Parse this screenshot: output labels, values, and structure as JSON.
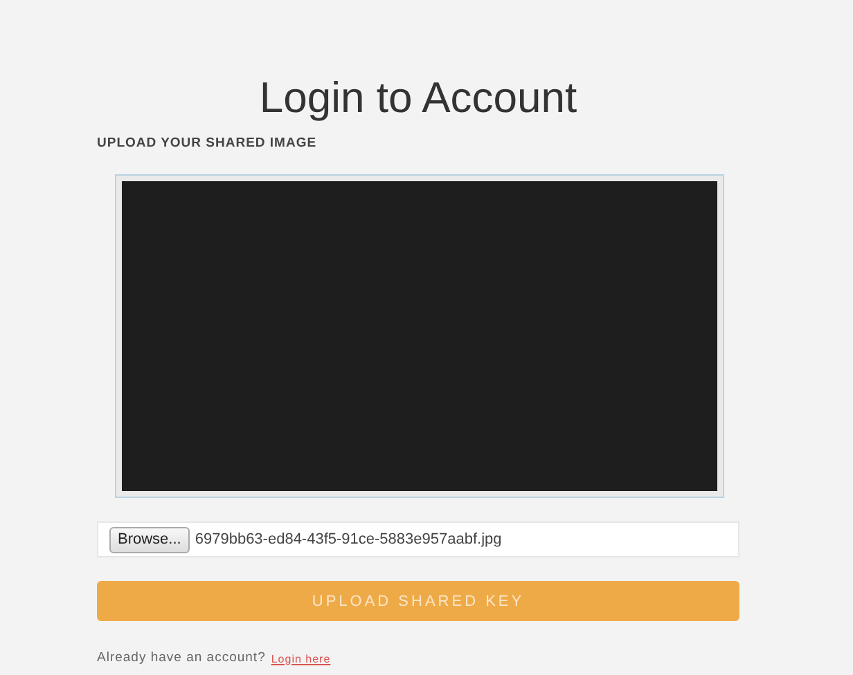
{
  "title": "Login to Account",
  "section_label": "UPLOAD YOUR SHARED IMAGE",
  "file_input": {
    "button": "Browse...",
    "value": "6979bb63-ed84-43f5-91ce-5883e957aabf.jpg"
  },
  "submit_button": "UPLOAD SHARED KEY",
  "footer": {
    "text": "Already have an account?",
    "link": "Login here"
  }
}
